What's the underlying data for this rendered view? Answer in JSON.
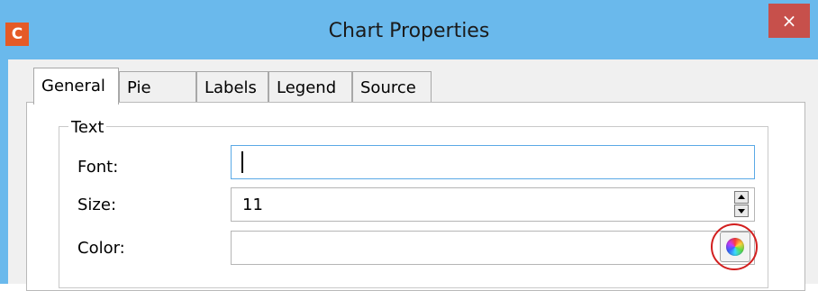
{
  "window": {
    "title": "Chart Properties",
    "app_icon_letter": "C",
    "close_symbol": "×",
    "accent": "#6ab9ec",
    "close_color": "#c7504b"
  },
  "tabs": [
    {
      "label": "General",
      "active": true
    },
    {
      "label": "Pie",
      "active": false
    },
    {
      "label": "Labels",
      "active": false
    },
    {
      "label": "Legend",
      "active": false
    },
    {
      "label": "Source",
      "active": false
    }
  ],
  "text_group": {
    "title": "Text",
    "font": {
      "label": "Font:",
      "value": ""
    },
    "size": {
      "label": "Size:",
      "value": "11"
    },
    "color": {
      "label": "Color:",
      "value": "",
      "picker_icon": "color-wheel-icon"
    }
  },
  "annotation": {
    "color": "#d21f1f",
    "target": "color-picker-button"
  }
}
